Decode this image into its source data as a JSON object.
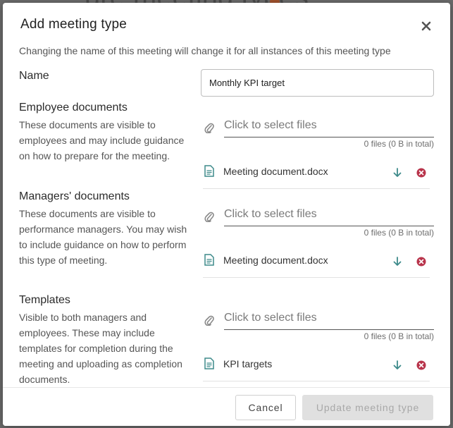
{
  "background": {
    "title": "ure meeting types"
  },
  "dialog": {
    "title": "Add meeting type",
    "subtitle": "Changing the name of this meeting will change it for all instances of this meeting type"
  },
  "name_field": {
    "label": "Name",
    "value": "Monthly KPI target"
  },
  "sections": [
    {
      "label": "Employee documents",
      "description": "These documents are visible to employees and may include guidance on how to prepare for the meeting.",
      "picker_placeholder": "Click to select files",
      "file_count": "0 files (0 B in total)",
      "files": [
        {
          "name": "Meeting document.docx"
        }
      ]
    },
    {
      "label": "Managers' documents",
      "description": "These documents are visible to performance managers. You may wish to include guidance on how to perform this type of meeting.",
      "picker_placeholder": "Click to select files",
      "file_count": "0 files (0 B in total)",
      "files": [
        {
          "name": "Meeting document.docx"
        }
      ]
    },
    {
      "label": "Templates",
      "description": "Visible to both managers and employees. These may include templates for completion during the meeting and uploading as completion documents.",
      "picker_placeholder": "Click to select files",
      "file_count": "0 files (0 B in total)",
      "files": [
        {
          "name": "KPI targets"
        }
      ]
    }
  ],
  "footer": {
    "cancel_label": "Cancel",
    "update_label": "Update meeting type"
  },
  "colors": {
    "accent": "#3d8a8a",
    "remove": "#b8334a",
    "disabled_bg": "#e0e0e0"
  },
  "icons": {
    "close": "close-icon",
    "attach": "paperclip-icon",
    "document": "document-icon",
    "download": "download-arrow-icon",
    "remove": "remove-circle-icon"
  }
}
